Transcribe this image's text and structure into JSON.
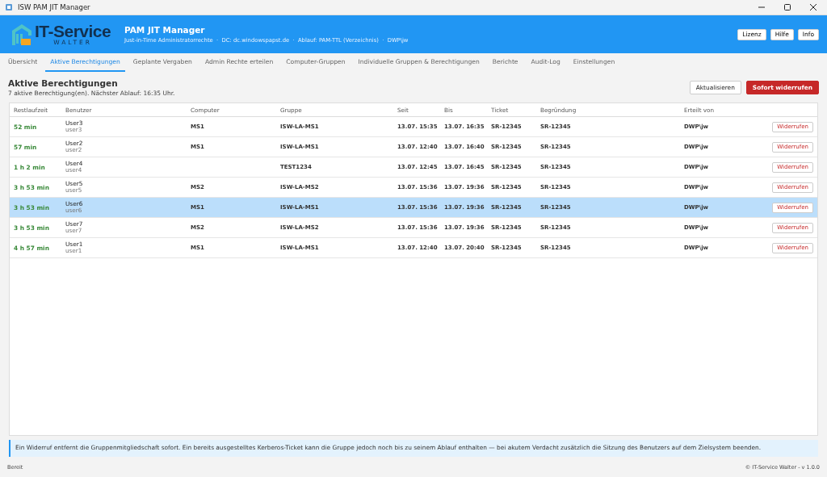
{
  "window": {
    "title": "ISW PAM JIT Manager"
  },
  "header": {
    "logo_text": "IT-Service",
    "logo_subtext": "WALTER",
    "title": "PAM JIT Manager",
    "subtitle": "Just-in-Time Administratorrechte  ·  DC: dc.windowspapst.de  ·  Ablauf: PAM-TTL (Verzeichnis)  ·  DWP\\jw",
    "buttons": [
      "Lizenz",
      "Hilfe",
      "Info"
    ]
  },
  "tabs": [
    {
      "label": "Übersicht",
      "selected": false
    },
    {
      "label": "Aktive Berechtigungen",
      "selected": true
    },
    {
      "label": "Geplante Vergaben",
      "selected": false
    },
    {
      "label": "Admin Rechte erteilen",
      "selected": false
    },
    {
      "label": "Computer-Gruppen",
      "selected": false
    },
    {
      "label": "Individuelle Gruppen & Berechtigungen",
      "selected": false
    },
    {
      "label": "Berichte",
      "selected": false
    },
    {
      "label": "Audit-Log",
      "selected": false
    },
    {
      "label": "Einstellungen",
      "selected": false
    }
  ],
  "page": {
    "title": "Aktive Berechtigungen",
    "summary": "7 aktive Berechtigung(en). Nächster Ablauf: 16:35 Uhr.",
    "buttons": [
      {
        "label": "Aktualisieren",
        "kind": "secondary"
      },
      {
        "label": "Sofort widerrufen",
        "kind": "danger"
      }
    ]
  },
  "table": {
    "columns": [
      "Restlaufzeit",
      "Benutzer",
      "Computer",
      "Gruppe",
      "Seit",
      "Bis",
      "Ticket",
      "Begründung",
      "Erteilt von"
    ],
    "rows": [
      {
        "remaining": "52 min",
        "user": "User3",
        "login": "user3",
        "computer": "MS1",
        "group": "ISW-LA-MS1",
        "since": "13.07. 15:35",
        "until": "13.07. 16:35",
        "ticket": "SR-12345",
        "reason": "SR-12345",
        "granted_by": "DWP\\jw",
        "action": "Widerrufen",
        "selected": false
      },
      {
        "remaining": "57 min",
        "user": "User2",
        "login": "user2",
        "computer": "MS1",
        "group": "ISW-LA-MS1",
        "since": "13.07. 12:40",
        "until": "13.07. 16:40",
        "ticket": "SR-12345",
        "reason": "SR-12345",
        "granted_by": "DWP\\jw",
        "action": "Widerrufen",
        "selected": false
      },
      {
        "remaining": "1 h 2 min",
        "user": "User4",
        "login": "user4",
        "group": "TEST1234",
        "since": "13.07. 12:45",
        "until": "13.07. 16:45",
        "ticket": "SR-12345",
        "reason": "SR-12345",
        "granted_by": "DWP\\jw",
        "action": "Widerrufen",
        "selected": false
      },
      {
        "remaining": "3 h 53 min",
        "user": "User5",
        "login": "user5",
        "computer": "MS2",
        "group": "ISW-LA-MS2",
        "since": "13.07. 15:36",
        "until": "13.07. 19:36",
        "ticket": "SR-12345",
        "reason": "SR-12345",
        "granted_by": "DWP\\jw",
        "action": "Widerrufen",
        "selected": false
      },
      {
        "remaining": "3 h 53 min",
        "user": "User6",
        "login": "user6",
        "computer": "MS1",
        "group": "ISW-LA-MS1",
        "since": "13.07. 15:36",
        "until": "13.07. 19:36",
        "ticket": "SR-12345",
        "reason": "SR-12345",
        "granted_by": "DWP\\jw",
        "action": "Widerrufen",
        "selected": true
      },
      {
        "remaining": "3 h 53 min",
        "user": "User7",
        "login": "user7",
        "computer": "MS2",
        "group": "ISW-LA-MS2",
        "since": "13.07. 15:36",
        "until": "13.07. 19:36",
        "ticket": "SR-12345",
        "reason": "SR-12345",
        "granted_by": "DWP\\jw",
        "action": "Widerrufen",
        "selected": false
      },
      {
        "remaining": "4 h 57 min",
        "user": "User1",
        "login": "user1",
        "computer": "MS1",
        "group": "ISW-LA-MS1",
        "since": "13.07. 12:40",
        "until": "13.07. 20:40",
        "ticket": "SR-12345",
        "reason": "SR-12345",
        "granted_by": "DWP\\jw",
        "action": "Widerrufen",
        "selected": false
      }
    ]
  },
  "info_note": "Ein Widerruf entfernt die Gruppenmitgliedschaft sofort. Ein bereits ausgestelltes Kerberos-Ticket kann die Gruppe jedoch noch bis zu seinem Ablauf enthalten — bei akutem Verdacht zusätzlich die Sitzung des Benutzers auf dem Zielsystem beenden.",
  "status_bar": {
    "left": "Bereit",
    "right": "© IT-Service Walter  - v 1.0.0"
  }
}
